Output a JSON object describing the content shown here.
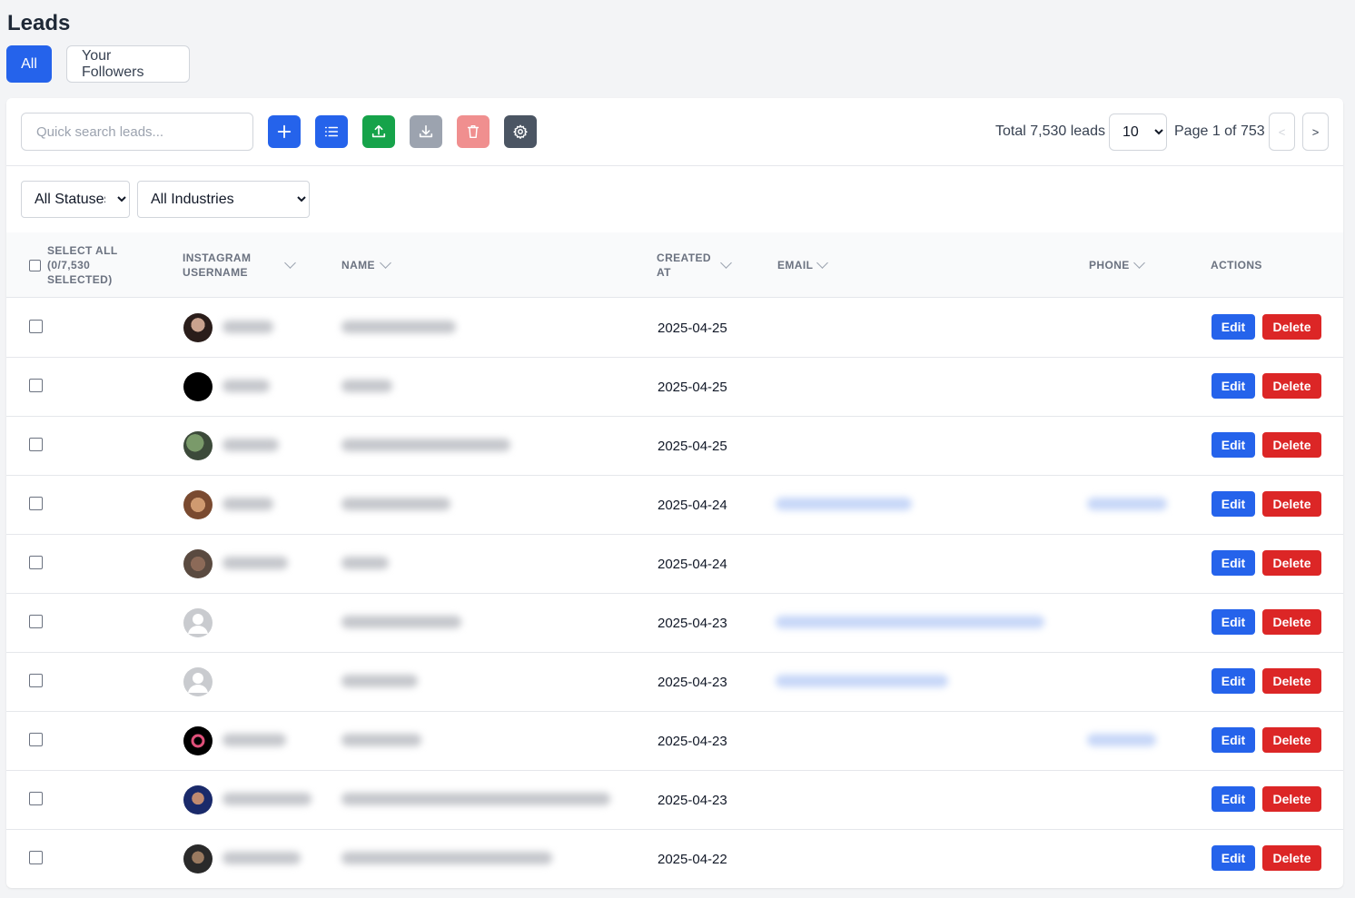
{
  "page": {
    "title": "Leads"
  },
  "tabs": [
    {
      "label": "All",
      "active": true
    },
    {
      "label": "Your Followers",
      "active": false
    }
  ],
  "toolbar": {
    "search_placeholder": "Quick search leads...",
    "buttons": [
      {
        "icon": "plus-icon",
        "color": "#2563eb"
      },
      {
        "icon": "list-icon",
        "color": "#2563eb"
      },
      {
        "icon": "upload-icon",
        "color": "#16a34a"
      },
      {
        "icon": "download-icon",
        "color": "#9ca3af"
      },
      {
        "icon": "trash-icon",
        "color": "#f08f8f"
      },
      {
        "icon": "gear-icon",
        "color": "#4b5563"
      }
    ],
    "total": "Total 7,530 leads",
    "page_size": "10",
    "page_info": "Page 1 of 753",
    "prev": "<",
    "next": ">"
  },
  "filters": {
    "status": "All Statuses",
    "industry": "All Industries"
  },
  "table": {
    "columns": {
      "select_all": "SELECT ALL (0/7,530 SELECTED)",
      "instagram": "INSTAGRAM USERNAME",
      "name": "NAME",
      "created": "CREATED AT",
      "email": "EMAIL",
      "phone": "PHONE",
      "actions": "ACTIONS"
    },
    "edit_label": "Edit",
    "delete_label": "Delete",
    "rows": [
      {
        "created": "2025-04-25"
      },
      {
        "created": "2025-04-25"
      },
      {
        "created": "2025-04-25"
      },
      {
        "created": "2025-04-24"
      },
      {
        "created": "2025-04-24"
      },
      {
        "created": "2025-04-23"
      },
      {
        "created": "2025-04-23"
      },
      {
        "created": "2025-04-23"
      },
      {
        "created": "2025-04-23"
      },
      {
        "created": "2025-04-22"
      }
    ]
  },
  "colors": {
    "primary": "#2563eb",
    "danger": "#dc2626",
    "success": "#16a34a"
  }
}
